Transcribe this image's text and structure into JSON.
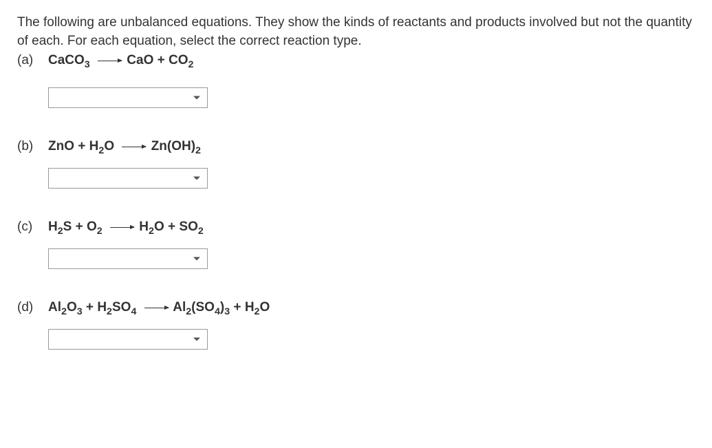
{
  "intro": "The following are unbalanced equations. They show the kinds of reactants and products involved but not the quantity of each. For each equation, select the correct reaction type.",
  "questions": [
    {
      "label": "(a)",
      "reactants": [
        {
          "base": "CaCO",
          "sub": "3"
        }
      ],
      "products": [
        {
          "base": "CaO",
          "sub": ""
        },
        {
          "base": "CO",
          "sub": "2"
        }
      ],
      "selected": ""
    },
    {
      "label": "(b)",
      "reactants": [
        {
          "base": "ZnO",
          "sub": ""
        },
        {
          "base": "H",
          "sub": "2",
          "base2": "O"
        }
      ],
      "products": [
        {
          "base": "Zn(OH)",
          "sub": "2"
        }
      ],
      "selected": ""
    },
    {
      "label": "(c)",
      "reactants": [
        {
          "base": "H",
          "sub": "2",
          "base2": "S"
        },
        {
          "base": "O",
          "sub": "2"
        }
      ],
      "products": [
        {
          "base": "H",
          "sub": "2",
          "base2": "O"
        },
        {
          "base": "SO",
          "sub": "2"
        }
      ],
      "selected": ""
    },
    {
      "label": "(d)",
      "reactants": [
        {
          "base": "Al",
          "sub": "2",
          "base2": "O",
          "sub2": "3"
        },
        {
          "base": "H",
          "sub": "2",
          "base2": "SO",
          "sub2": "4"
        }
      ],
      "products": [
        {
          "base": "Al",
          "sub": "2",
          "base2": "(SO",
          "sub2": "4",
          "base3": ")",
          "sub3": "3"
        },
        {
          "base": "H",
          "sub": "2",
          "base2": "O"
        }
      ],
      "selected": ""
    }
  ]
}
